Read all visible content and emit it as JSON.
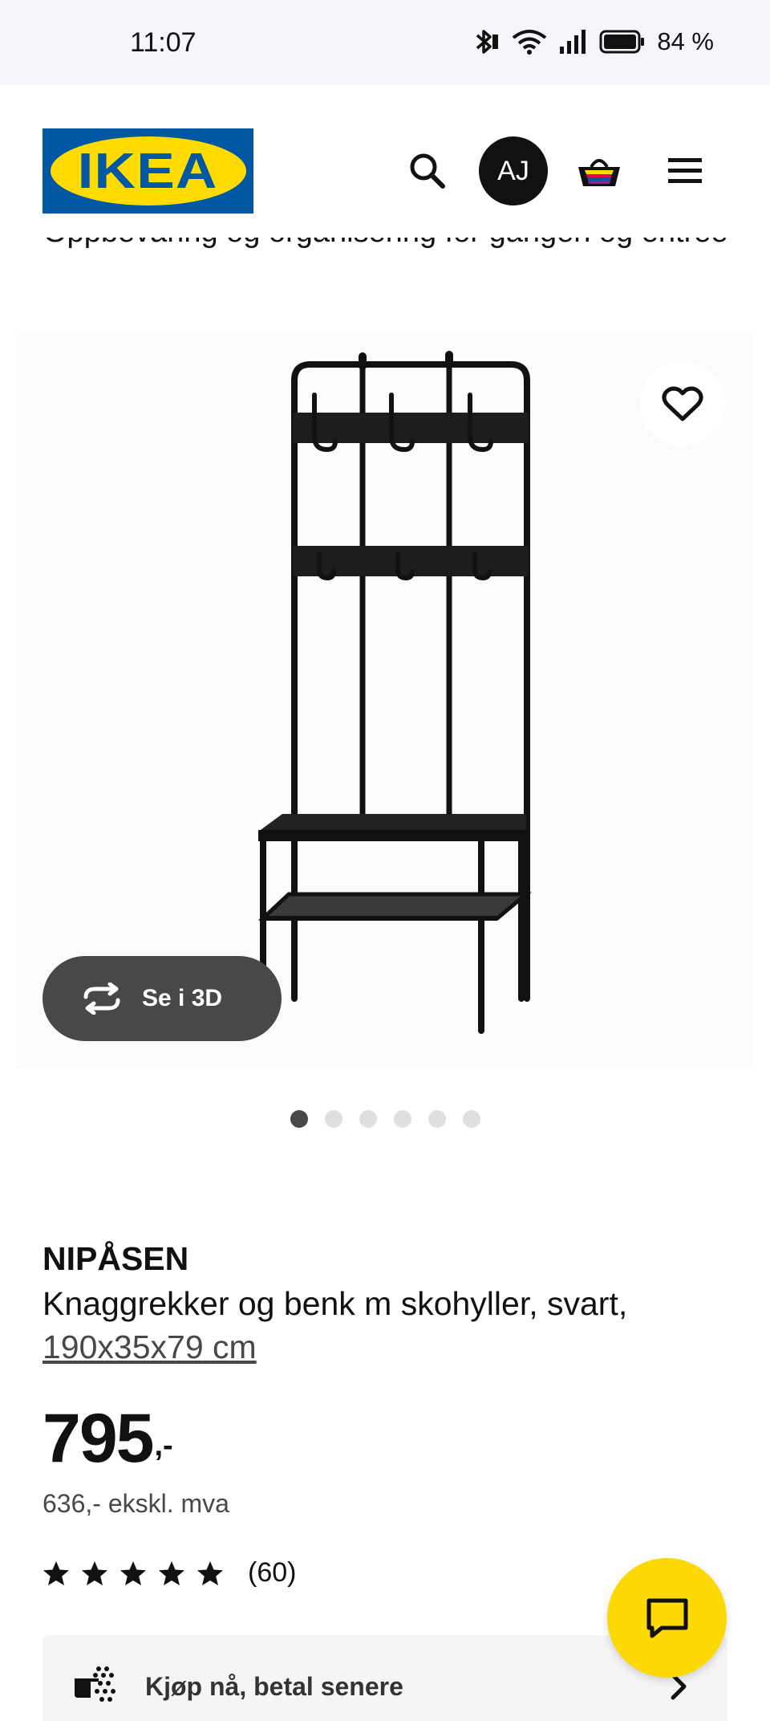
{
  "status_bar": {
    "time": "11:07",
    "battery": "84 %",
    "icons": [
      "bluetooth-icon",
      "wifi-icon",
      "signal-icon",
      "battery-icon"
    ]
  },
  "header": {
    "logo_text": "IKEA",
    "avatar_initials": "AJ",
    "cut_off_text": "Oppbevaring og organisering for gangen og entreen",
    "icons": [
      "search-icon",
      "cart-icon",
      "menu-icon"
    ]
  },
  "gallery": {
    "view_3d_label": "Se i 3D",
    "dots_count": 6,
    "active_dot": 0
  },
  "product": {
    "name": "NIPÅSEN",
    "description": "Knaggrekker og benk m skohyller, svart,",
    "size": "190x35x79 cm",
    "price": "795",
    "price_suffix": ",-",
    "price_ex_vat": "636,- ekskl. mva",
    "rating_stars": 5,
    "rating_count": "(60)"
  },
  "klarna": {
    "label": "Kjøp nå, betal senere"
  },
  "colors": {
    "ikea_blue": "#0058a3",
    "ikea_yellow": "#ffdb00",
    "chat_yellow": "#fcd805",
    "dark": "#111111"
  }
}
